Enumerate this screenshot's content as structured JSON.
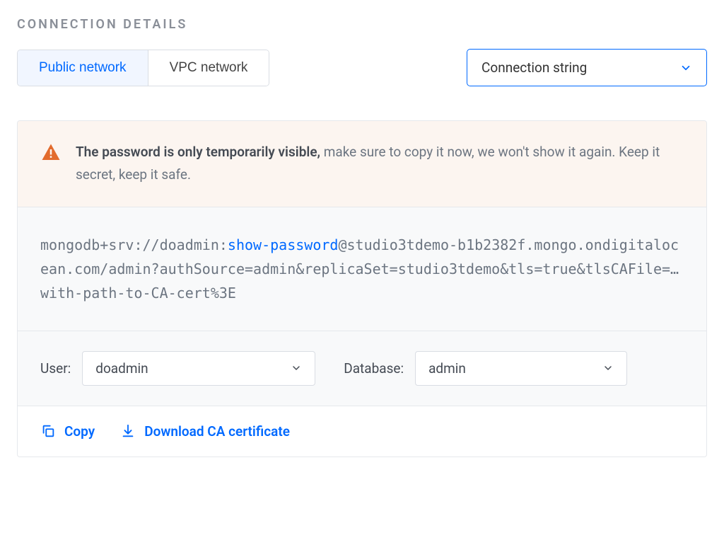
{
  "section_title": "CONNECTION DETAILS",
  "tabs": {
    "public": "Public network",
    "vpc": "VPC network"
  },
  "format_dropdown": {
    "selected": "Connection string"
  },
  "alert": {
    "bold": "The password is only temporarily visible,",
    "rest": " make sure to copy it now, we won't show it again. Keep it secret, keep it safe."
  },
  "connection_string": {
    "prefix": "mongodb+srv://doadmin:",
    "show_password": "show-password",
    "suffix": "@studio3tdemo-b1b2382f.mongo.ondigitalocean.com/admin?authSource=admin&replicaSet=studio3tdemo&tls=true&tlsCAFile=…with-path-to-CA-cert%3E"
  },
  "selectors": {
    "user_label": "User:",
    "user_value": "doadmin",
    "database_label": "Database:",
    "database_value": "admin"
  },
  "actions": {
    "copy": "Copy",
    "download": "Download CA certificate"
  }
}
